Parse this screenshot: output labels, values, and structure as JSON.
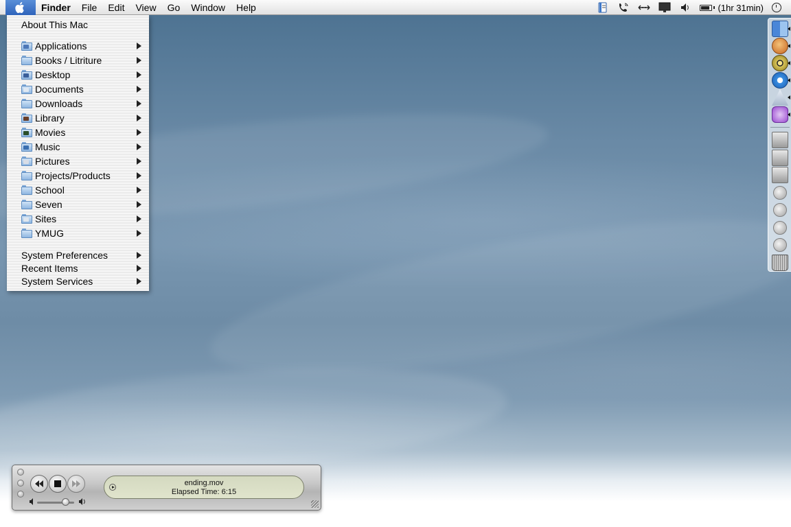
{
  "menubar": {
    "app_name": "Finder",
    "menus": [
      "File",
      "Edit",
      "View",
      "Go",
      "Window",
      "Help"
    ],
    "extras": {
      "icons": [
        "script-icon",
        "phone-icon",
        "network-icon",
        "display-icon",
        "volume-icon"
      ],
      "battery_text": "(1hr 31min)"
    }
  },
  "apple_menu": {
    "about": "About This Mac",
    "folders": [
      {
        "label": "Applications",
        "icon": "applications-folder-icon"
      },
      {
        "label": "Books / Litriture",
        "icon": "folder-icon"
      },
      {
        "label": "Desktop",
        "icon": "desktop-folder-icon"
      },
      {
        "label": "Documents",
        "icon": "documents-folder-icon"
      },
      {
        "label": "Downloads",
        "icon": "folder-icon"
      },
      {
        "label": "Library",
        "icon": "library-folder-icon"
      },
      {
        "label": "Movies",
        "icon": "movies-folder-icon"
      },
      {
        "label": "Music",
        "icon": "music-folder-icon"
      },
      {
        "label": "Pictures",
        "icon": "pictures-folder-icon"
      },
      {
        "label": "Projects/Products",
        "icon": "folder-icon"
      },
      {
        "label": "School",
        "icon": "folder-icon"
      },
      {
        "label": "Seven",
        "icon": "folder-icon"
      },
      {
        "label": "Sites",
        "icon": "sites-folder-icon"
      },
      {
        "label": "YMUG",
        "icon": "folder-icon"
      }
    ],
    "bottom": [
      "System Preferences",
      "Recent Items",
      "System Services"
    ]
  },
  "dock": {
    "items": [
      "finder-icon",
      "ichat-icon",
      "itunes-icon",
      "internet-explorer-icon",
      "mail-icon",
      "emacs-icon",
      "hard-disk-icon",
      "hard-disk-icon",
      "hard-disk-icon",
      "network-volume-icon",
      "network-volume-icon",
      "network-volume-icon",
      "network-volume-icon",
      "trash-icon"
    ]
  },
  "player": {
    "filename": "ending.mov",
    "elapsed": "Elapsed Time: 6:15",
    "volume_fraction": 0.75
  },
  "colors": {
    "menu_highlight": "#2f64bb",
    "folder_blue": "#8fb6e0"
  }
}
